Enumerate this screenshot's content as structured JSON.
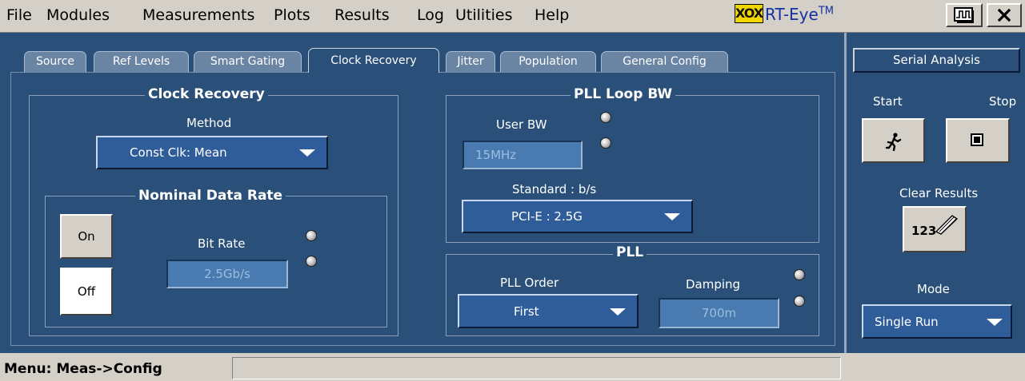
{
  "menu": {
    "file": "File",
    "modules": "Modules",
    "measurements": "Measurements",
    "plots": "Plots",
    "results": "Results",
    "log": "Log",
    "utilities": "Utilities",
    "help": "Help"
  },
  "brand": {
    "logo": "XOX",
    "name": "RT-Eye",
    "tm": "TM"
  },
  "tabs": [
    "Source",
    "Ref Levels",
    "Smart Gating",
    "Clock Recovery",
    "Jitter",
    "Population",
    "General Config"
  ],
  "clock_recovery": {
    "title": "Clock Recovery",
    "method_label": "Method",
    "method_value": "Const Clk: Mean",
    "nominal": {
      "title": "Nominal Data Rate",
      "on_label": "On",
      "off_label": "Off",
      "bitrate_label": "Bit Rate",
      "bitrate_value": "2.5Gb/s"
    }
  },
  "pll_loop": {
    "title": "PLL Loop BW",
    "user_bw_label": "User BW",
    "user_bw_value": "15MHz",
    "standard_label": "Standard : b/s",
    "standard_value": "PCI-E : 2.5G"
  },
  "pll": {
    "title": "PLL",
    "order_label": "PLL Order",
    "order_value": "First",
    "damping_label": "Damping",
    "damping_value": "700m"
  },
  "side": {
    "title": "Serial Analysis",
    "start_label": "Start",
    "stop_label": "Stop",
    "clear_label": "Clear Results",
    "clear_icon_text": "123",
    "mode_label": "Mode",
    "mode_value": "Single Run"
  },
  "status": {
    "menu_path": "Menu: Meas->Config"
  }
}
